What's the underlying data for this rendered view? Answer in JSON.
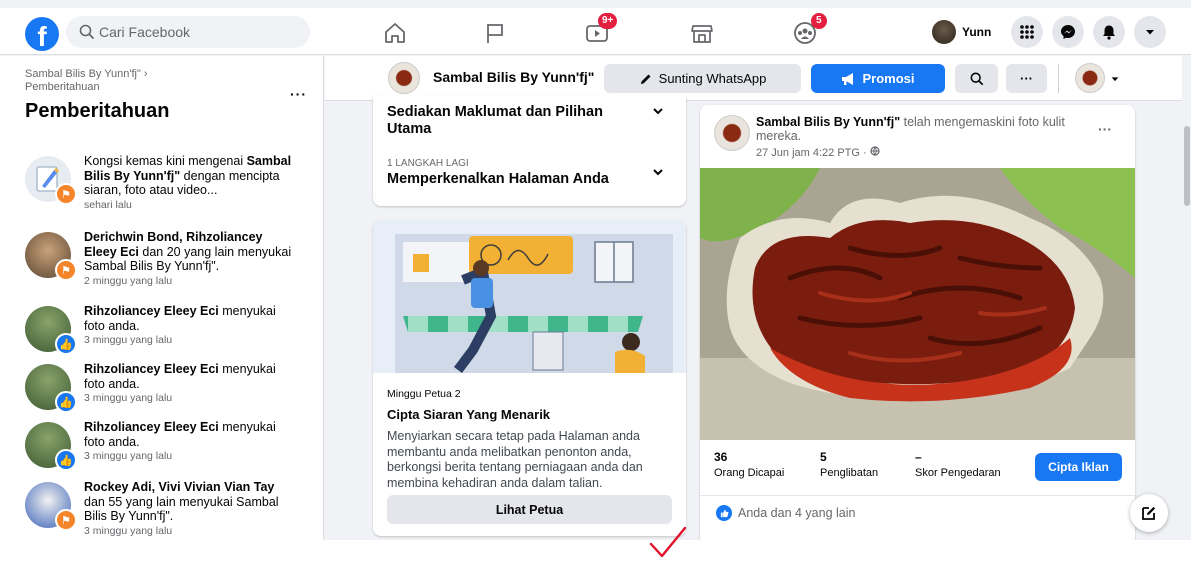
{
  "colors": {
    "brand": "#1877f2",
    "badge": "#e41e3f",
    "checkmark": "#e0102a"
  },
  "topbar": {
    "search_placeholder": "Cari Facebook",
    "watch_badge": "9+",
    "groups_badge": "5",
    "profile_name": "Yunn",
    "icons": [
      "facebook-logo",
      "home-icon",
      "flag-icon",
      "watch-icon",
      "marketplace-icon",
      "groups-icon",
      "menu-grid-icon",
      "messenger-icon",
      "bell-icon",
      "caret-down-icon"
    ]
  },
  "left": {
    "breadcrumb_page": "Sambal Bilis By Yunn'fj\" ›",
    "breadcrumb_current": "Pemberitahuan",
    "title": "Pemberitahuan",
    "notifications": [
      {
        "pre": "Kongsi kemas kini mengenai ",
        "bold": "Sambal Bilis By Yunn'fj\"",
        "post": " dengan mencipta siaran, foto atau video...",
        "time": "sehari lalu"
      },
      {
        "pre": "",
        "bold": "Derichwin Bond, Rihzoliancey Eleey Eci",
        "post": " dan 20 yang lain menyukai Sambal Bilis By Yunn'fj\".",
        "time": "2 minggu yang lalu"
      },
      {
        "pre": "",
        "bold": "Rihzoliancey Eleey Eci",
        "post": " menyukai foto anda.",
        "time": "3 minggu yang lalu"
      },
      {
        "pre": "",
        "bold": "Rihzoliancey Eleey Eci",
        "post": " menyukai foto anda.",
        "time": "3 minggu yang lalu"
      },
      {
        "pre": "",
        "bold": "Rihzoliancey Eleey Eci",
        "post": " menyukai foto anda.",
        "time": "3 minggu yang lalu"
      },
      {
        "pre": "",
        "bold": "Rockey Adi, Vivi Vivian Vian Tay",
        "post": " dan 55 yang lain menyukai Sambal Bilis By Yunn'fj\".",
        "time": "3 minggu yang lalu"
      }
    ]
  },
  "pagebar": {
    "page_name": "Sambal Bilis By Yunn'fj\"",
    "whatsapp_label": "Sunting WhatsApp",
    "promote_label": "Promosi"
  },
  "setup": {
    "item1_title": "Sediakan Maklumat dan Pilihan Utama",
    "item2_step": "1 LANGKAH LAGI",
    "item2_title": "Memperkenalkan Halaman Anda"
  },
  "guide": {
    "week": "Minggu Petua 2",
    "title": "Cipta Siaran Yang Menarik",
    "body": "Menyiarkan secara tetap pada Halaman anda membantu anda melibatkan penonton anda, berkongsi berita tentang perniagaan anda dan membina kehadiran anda dalam talian.",
    "button": "Lihat Petua"
  },
  "post": {
    "author": "Sambal Bilis By Yunn'fj\"",
    "action": " telah mengemaskini foto kulit mereka.",
    "time": "27 Jun jam 4:22 PTG · ",
    "stats": [
      {
        "value": "36",
        "label": "Orang Dicapai"
      },
      {
        "value": "5",
        "label": "Penglibatan"
      },
      {
        "value": "–",
        "label": "Skor Pengedaran"
      }
    ],
    "cta": "Cipta Iklan",
    "reactions": "Anda dan 4 yang lain"
  }
}
